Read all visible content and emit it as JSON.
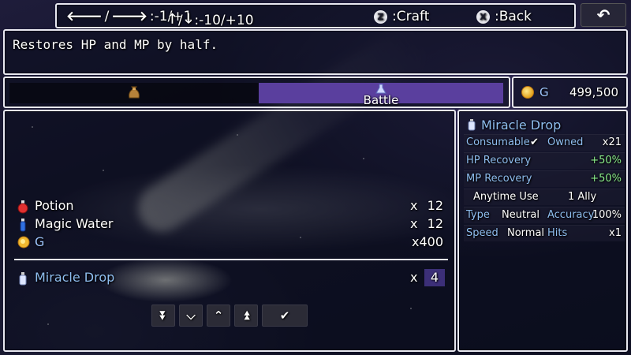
{
  "help_bar": {
    "horizontal": ":-1/+1",
    "vertical": ":-10/+10",
    "craft_key": "Z",
    "craft_label": ":Craft",
    "back_key": "X",
    "back_label": ":Back"
  },
  "description": "Restores HP and MP by half.",
  "tabs": [
    {
      "label": "",
      "icon": "bag-icon",
      "selected": false
    },
    {
      "label": "Battle",
      "icon": "flask-icon",
      "selected": true
    }
  ],
  "gold": {
    "unit": "G",
    "value": "499,500"
  },
  "ingredients": [
    {
      "name": "Potion",
      "x": "x",
      "qty": "12",
      "icon": "red-potion-icon"
    },
    {
      "name": "Magic Water",
      "x": "x",
      "qty": "12",
      "icon": "blue-potion-icon"
    },
    {
      "name": "G",
      "x": "",
      "qty": "x400",
      "icon": "gold-coin-icon"
    }
  ],
  "result": {
    "name": "Miracle Drop",
    "x": "x",
    "qty": "4",
    "icon": "drop-bottle-icon"
  },
  "detail": {
    "title": "Miracle Drop",
    "consumable_label": "Consumable",
    "owned_label": "Owned",
    "owned_value": "x21",
    "hp_label": "HP Recovery",
    "hp_value": "+50%",
    "mp_label": "MP Recovery",
    "mp_value": "+50%",
    "occasion": "Anytime Use",
    "scope": "1 Ally",
    "type_label": "Type",
    "type_value": "Neutral",
    "accuracy_label": "Accuracy",
    "accuracy_value": "100%",
    "speed_label": "Speed",
    "speed_value": "Normal",
    "hits_label": "Hits",
    "hits_value": "x1"
  },
  "colors": {
    "accent_blue": "#8fbef0",
    "selected_tab": "#5a3f9e",
    "quantity_box": "#3c2f78",
    "positive": "#8cf08c"
  }
}
